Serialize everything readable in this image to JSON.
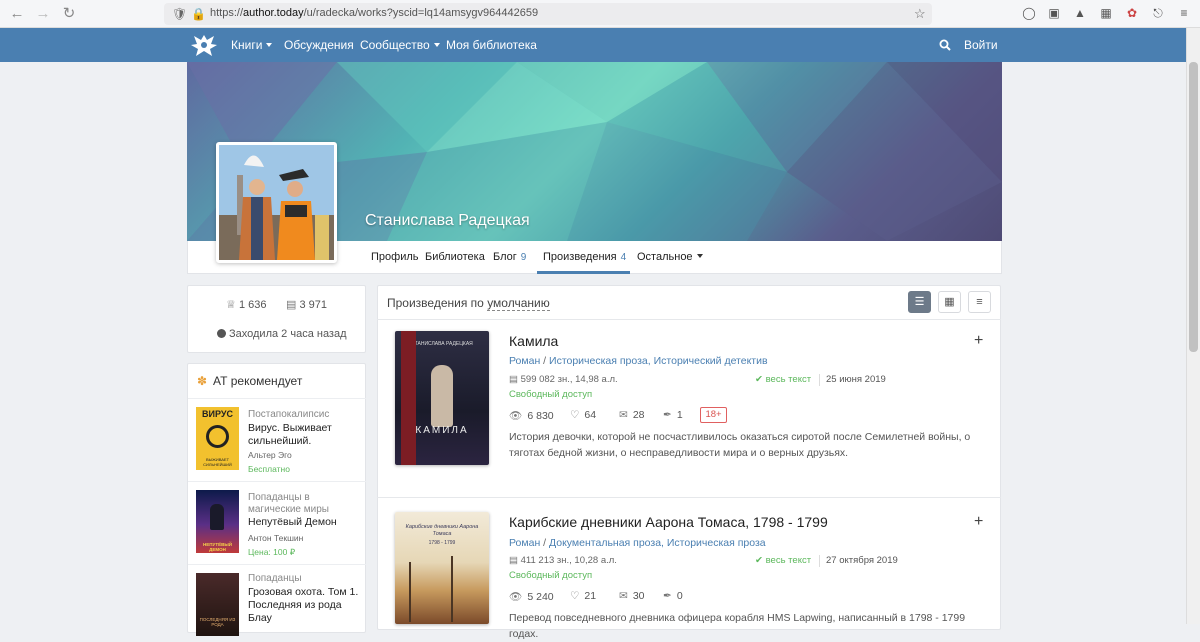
{
  "browser": {
    "url_prefix": "https://",
    "url_host": "author.today",
    "url_path": "/u/radecka/works?yscid=lq14amsygv964442659"
  },
  "nav": {
    "items": [
      {
        "label": "Книги",
        "has_caret": true
      },
      {
        "label": "Обсуждения",
        "has_caret": false
      },
      {
        "label": "Сообщество",
        "has_caret": true
      },
      {
        "label": "Моя библиотека",
        "has_caret": false
      }
    ],
    "login_label": "Войти"
  },
  "profile": {
    "name": "Станислава Радецкая",
    "tabs": [
      {
        "label": "Профиль",
        "count": ""
      },
      {
        "label": "Библиотека",
        "count": ""
      },
      {
        "label": "Блог",
        "count": "9"
      },
      {
        "label": "Произведения",
        "count": "4"
      },
      {
        "label": "Остальное",
        "count": ""
      }
    ],
    "stats": {
      "rating": "1 636",
      "views": "3 971"
    },
    "last_seen": "Заходила 2 часа назад"
  },
  "recommend": {
    "title": "АТ рекомендует",
    "items": [
      {
        "genre": "Постапокалипсис",
        "title": "Вирус. Выживает сильнейший.",
        "author": "Альтер Эго",
        "price": "Бесплатно"
      },
      {
        "genre": "Попаданцы в магические миры",
        "title": "Непутёвый Демон",
        "author": "Антон Текшин",
        "price": "Цена: 100 ₽"
      },
      {
        "genre": "Попаданцы",
        "title": "Грозовая охота. Том 1. Последняя из рода Блау",
        "author": "",
        "price": ""
      }
    ],
    "cover_texts": [
      "ВИРУС",
      "ВЫЖИВАЕТ СИЛЬНЕЙШИЙ",
      "НЕПУТЁВЫЙ ДЕМОН",
      "ПОСЛЕДНЯЯ ИЗ РОДА"
    ]
  },
  "works": {
    "heading": "Произведения по",
    "heading_sort": "умолчанию",
    "items": [
      {
        "title": "Камила",
        "genre_main": "Роман",
        "genre_sub": "Историческая проза, Исторический детектив",
        "size": "599 082 зн., 14,98 а.л.",
        "full_text": "весь текст",
        "date": "25 июня 2019",
        "access": "Свободный доступ",
        "views": "6 830",
        "likes": "64",
        "comments": "28",
        "rewards": "1",
        "age": "18+",
        "description": "История девочки, которой не посчастливилось оказаться сиротой после Семилетней войны, о тяготах бедной жизни, о несправедливости мира и о верных друзьях.",
        "cover_author": "СТАНИСЛАВА РАДЕЦКАЯ",
        "cover_title": "КАМИЛА"
      },
      {
        "title": "Карибские дневники Аарона Томаса, 1798 - 1799",
        "genre_main": "Роман",
        "genre_sub": "Документальная проза, Историческая проза",
        "size": "411 213 зн., 10,28 а.л.",
        "full_text": "весь текст",
        "date": "27 октября 2019",
        "access": "Свободный доступ",
        "views": "5 240",
        "likes": "21",
        "comments": "30",
        "rewards": "0",
        "description": "Перевод повседневного дневника офицера корабля HMS Lapwing, написанный в 1798 - 1799 годах.",
        "cover_title": "Карибские дневники Аарона Томаса",
        "cover_years": "1798 - 1799"
      }
    ]
  },
  "colors": {
    "nav": "#4a7fb1",
    "link": "#4a7fb1",
    "success": "#5cb85c",
    "age_badge": "#d9534f"
  },
  "icons": [
    "back-arrow-icon",
    "forward-arrow-icon",
    "reload-icon",
    "shield-icon",
    "lock-icon",
    "star-icon",
    "search-icon",
    "crown-icon",
    "book-icon",
    "heart-icon",
    "eye-icon",
    "comment-icon",
    "feather-icon",
    "check-icon",
    "plus-icon",
    "list-view-icon",
    "grid-view-icon",
    "menu-icon"
  ]
}
